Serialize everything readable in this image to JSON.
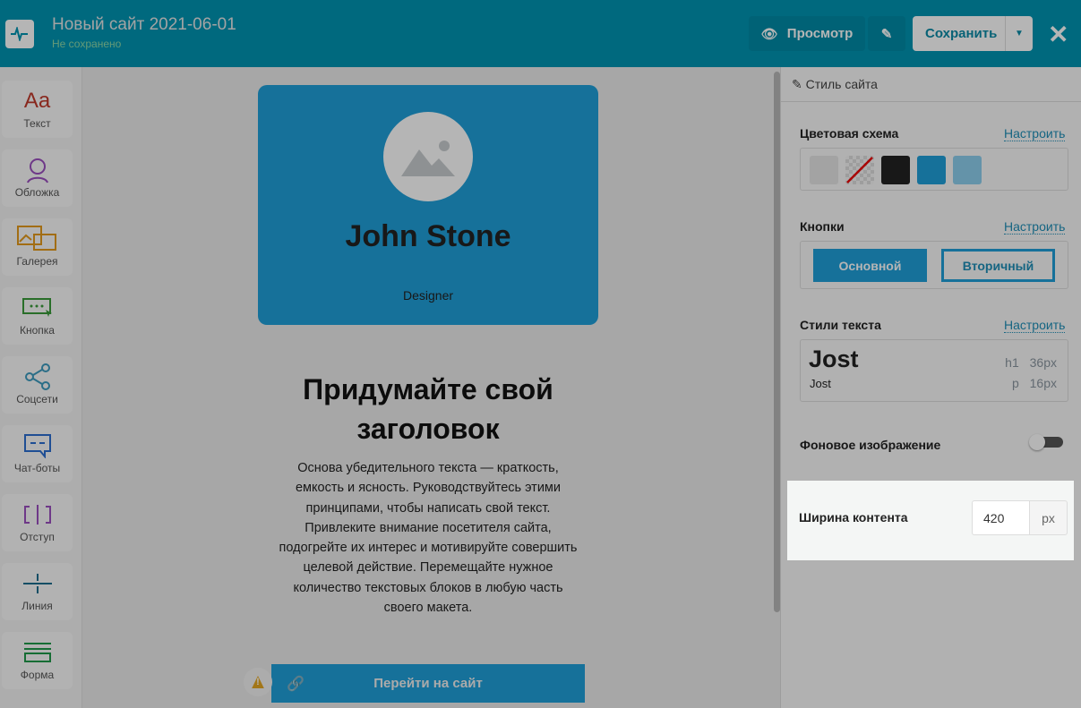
{
  "header": {
    "title": "Новый сайт 2021-06-01",
    "status": "Не сохранено",
    "preview_label": "Просмотр",
    "save_label": "Сохранить",
    "close": "✕"
  },
  "sidebar": {
    "items": [
      {
        "label": "Текст",
        "icon": "text-icon"
      },
      {
        "label": "Обложка",
        "icon": "cover-icon"
      },
      {
        "label": "Галерея",
        "icon": "gallery-icon"
      },
      {
        "label": "Кнопка",
        "icon": "button-icon"
      },
      {
        "label": "Соцсети",
        "icon": "share-icon"
      },
      {
        "label": "Чат-боты",
        "icon": "chat-icon"
      },
      {
        "label": "Отступ",
        "icon": "spacing-icon"
      },
      {
        "label": "Линия",
        "icon": "line-icon"
      },
      {
        "label": "Форма",
        "icon": "form-icon"
      }
    ],
    "text_glyph": "Aa"
  },
  "canvas": {
    "name": "John Stone",
    "role": "Designer",
    "heading": "Придумайте свой заголовок",
    "paragraph": "Основа убедительного текста — краткость, емкость и ясность. Руководствуйтесь этими принципами, чтобы написать свой текст. Привлеките внимание посетителя сайта, подогрейте их интерес и мотивируйте совершить целевой действие. Перемещайте нужное количество текстовых блоков в любую часть своего макета.",
    "go_button": "Перейти на сайт",
    "warning": "!"
  },
  "panel": {
    "title": "Стиль сайта",
    "color_scheme": {
      "label": "Цветовая схема",
      "configure": "Настроить",
      "colors": [
        "#e6e6e6",
        "transparent",
        "#222222",
        "#209fd9",
        "#8ed0ee"
      ]
    },
    "buttons": {
      "label": "Кнопки",
      "configure": "Настроить",
      "primary": "Основной",
      "secondary": "Вторичный"
    },
    "text_styles": {
      "label": "Стили текста",
      "configure": "Настроить",
      "heading_font": "Jost",
      "body_font": "Jost",
      "h1_tag": "h1",
      "h1_size": "36px",
      "p_tag": "p",
      "p_size": "16px"
    },
    "background_image": {
      "label": "Фоновое изображение",
      "enabled": false
    },
    "content_width": {
      "label": "Ширина контента",
      "value": "420",
      "unit": "px"
    }
  }
}
